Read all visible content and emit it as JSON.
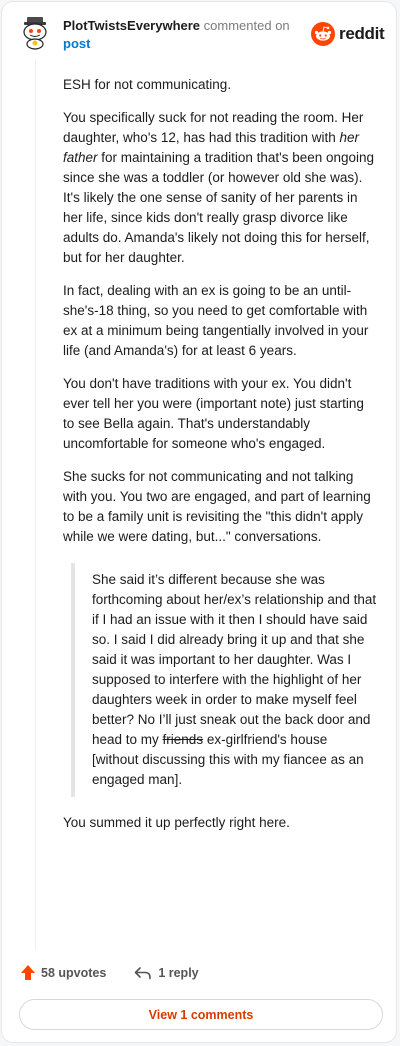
{
  "header": {
    "username": "PlotTwistsEverywhere",
    "commented_text": "commented on",
    "post_link": "post",
    "brand": "reddit"
  },
  "comment": {
    "p1": "ESH for not communicating.",
    "p2_a": "You specifically suck for not reading the room. Her daughter, who's 12, has had this tradition with ",
    "p2_em": "her father",
    "p2_b": " for maintaining a tradition that's been ongoing since she was a toddler (or however old she was). It's likely the one sense of sanity of her parents in her life, since kids don't really grasp divorce like adults do. Amanda's likely not doing this for herself, but for her daughter.",
    "p3": "In fact, dealing with an ex is going to be an until-she's-18 thing, so you need to get comfortable with ex at a minimum being tangentially involved in your life (and Amanda's) for at least 6 years.",
    "p4": "You don't have traditions with your ex. You didn't ever tell her you were (important note) just starting to see Bella again. That's understandably uncomfortable for someone who's engaged.",
    "p5": "She sucks for not communicating and not talking with you. You two are engaged, and part of learning to be a family unit is revisiting the \"this didn't apply while we were dating, but...\" conversations.",
    "quote_a": "She said it’s different because she was forthcoming about her/ex’s relationship and that if I had an issue with it then I should have said so. I said I did already bring it up and that she said it was important to her daughter. Was I supposed to interfere with the highlight of her daughters week in order to make myself feel better? No I’ll just sneak out the back door and head to my ",
    "quote_strike": "friends",
    "quote_b": " ex-girlfriend's house [without discussing this with my fiancee as an engaged man].",
    "p6": "You summed it up perfectly right here."
  },
  "actions": {
    "upvotes": "58 upvotes",
    "replies": "1 reply"
  },
  "footer": {
    "view_comments": "View 1 comments"
  },
  "colors": {
    "brand_orange": "#ff4500",
    "link_blue": "#0079d3",
    "button_text": "#d93a00"
  }
}
